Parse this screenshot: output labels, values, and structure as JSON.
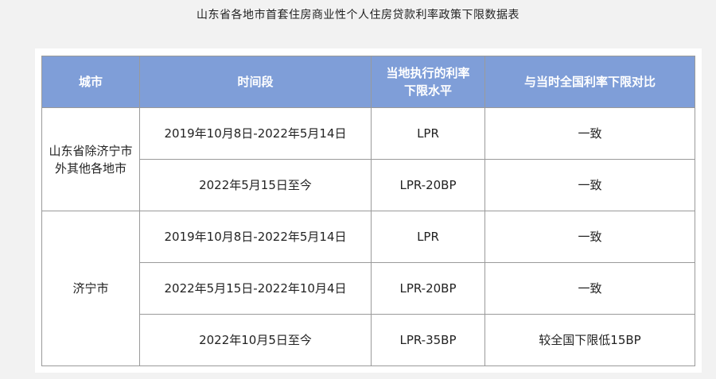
{
  "page": {
    "title": "山东省各地市首套住房商业性个人住房贷款利率政策下限数据表"
  },
  "table": {
    "headers": {
      "city": "城市",
      "period": "时间段",
      "rate_line1": "当地执行的利率",
      "rate_line2": "下限水平",
      "compare": "与当时全国利率下限对比"
    },
    "groups": [
      {
        "city_line1": "山东省除济宁市",
        "city_line2": "外其他各地市",
        "rows": [
          {
            "period": "2019年10月8日-2022年5月14日",
            "rate": "LPR",
            "compare": "一致"
          },
          {
            "period": "2022年5月15日至今",
            "rate": "LPR-20BP",
            "compare": "一致"
          }
        ]
      },
      {
        "city_line1": "济宁市",
        "rows": [
          {
            "period": "2019年10月8日-2022年5月14日",
            "rate": "LPR",
            "compare": "一致"
          },
          {
            "period": "2022年5月15日-2022年10月4日",
            "rate": "LPR-20BP",
            "compare": "一致"
          },
          {
            "period": "2022年10月5日至今",
            "rate": "LPR-35BP",
            "compare": "较全国下限低15BP"
          }
        ]
      }
    ]
  }
}
